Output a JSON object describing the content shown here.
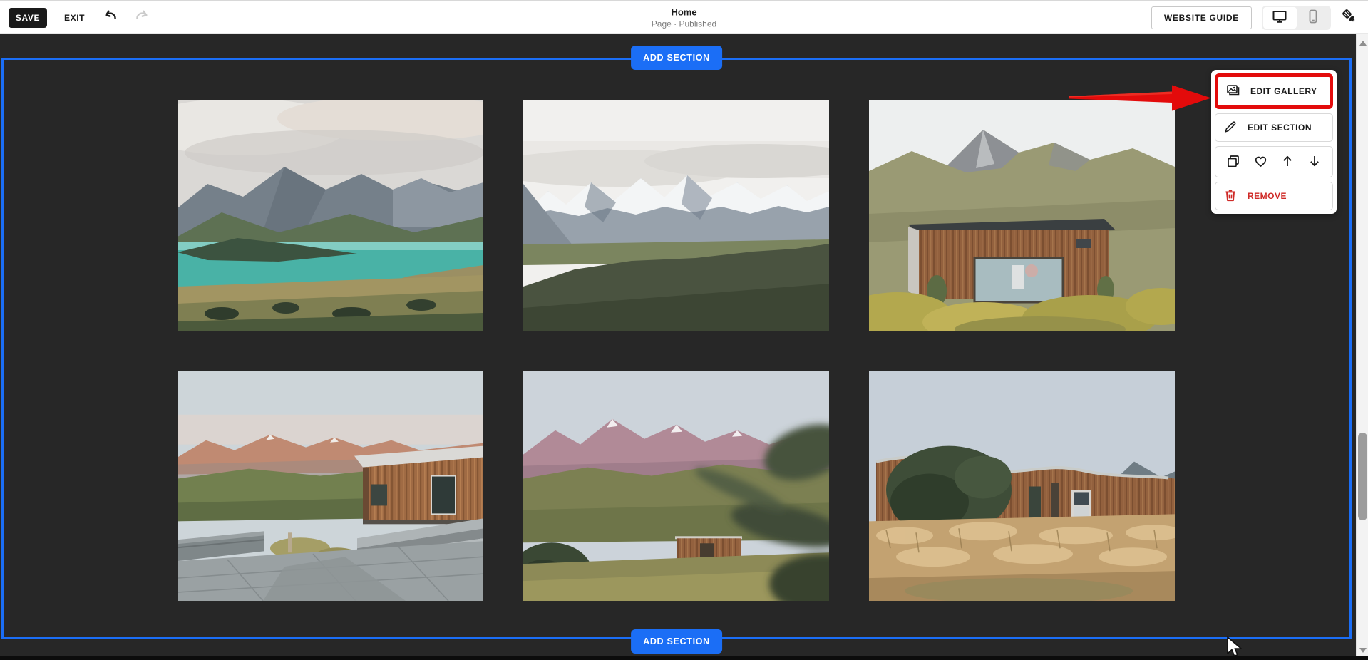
{
  "toolbar": {
    "save": "SAVE",
    "exit": "EXIT",
    "title": "Home",
    "status": "Page · Published",
    "website_guide": "WEBSITE GUIDE"
  },
  "section": {
    "add_section_top": "ADD SECTION",
    "add_section_bottom": "ADD SECTION"
  },
  "gallery": {
    "images": [
      {
        "alt": "Turquoise alpine lake below grey mountain range with tussock shoreline"
      },
      {
        "alt": "Snow-capped mountain range behind dark green ridge with small stone lodges"
      },
      {
        "alt": "Cedar cabin with full-width picture window on tussock hillside below rocky peak"
      },
      {
        "alt": "Stone terrace and cedar house at dusk with alpenglow on mountains"
      },
      {
        "alt": "Rolling tussock hills with small cedar cabin below pink snow-capped mountains"
      },
      {
        "alt": "Long cedar-clad building with wavy roofline in golden grass meadow"
      }
    ]
  },
  "menu": {
    "edit_gallery": "EDIT GALLERY",
    "edit_section": "EDIT SECTION",
    "remove": "REMOVE"
  },
  "colors": {
    "accent_blue": "#1b6ef6",
    "annotation_red": "#e30b0b",
    "remove_red": "#cf2a27",
    "canvas_dark": "#272727",
    "toolbar_bg": "#ffffff"
  }
}
